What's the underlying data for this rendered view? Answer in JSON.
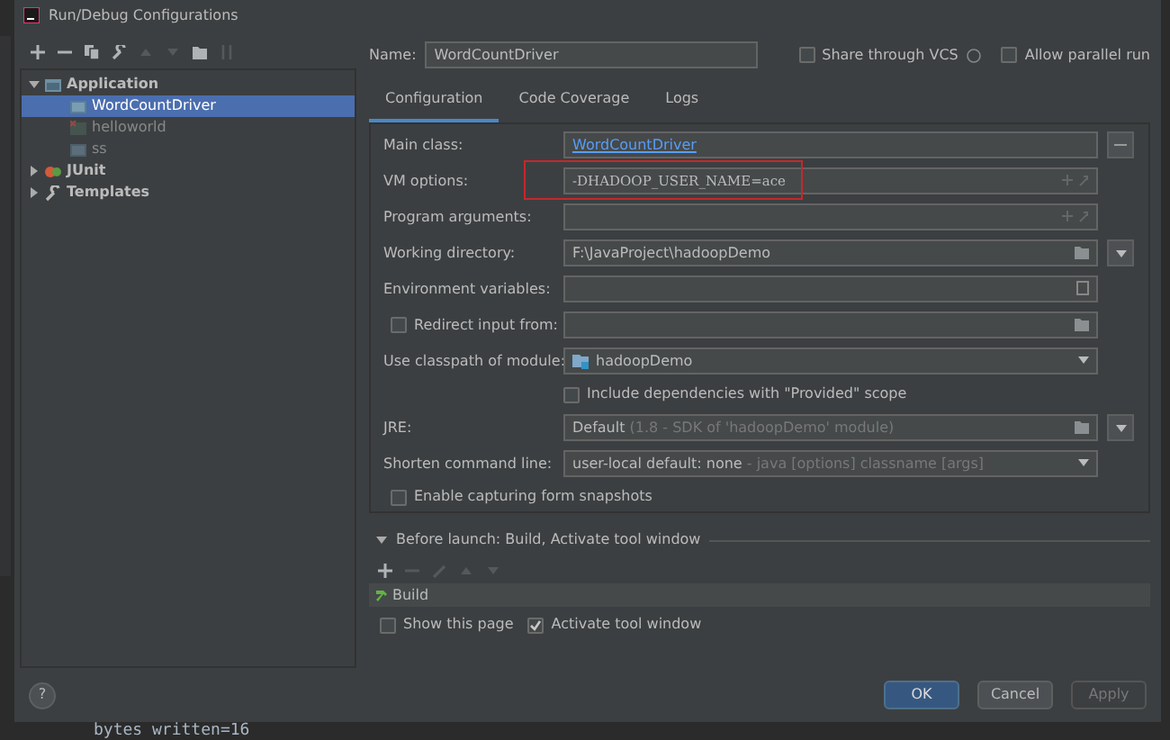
{
  "window": {
    "title": "Run/Debug Configurations"
  },
  "toolbar": [
    {
      "kind": "add",
      "disabled": false
    },
    {
      "kind": "remove",
      "disabled": false
    },
    {
      "kind": "copy",
      "disabled": false
    },
    {
      "kind": "wrench",
      "disabled": false
    },
    {
      "kind": "up",
      "disabled": true
    },
    {
      "kind": "down",
      "disabled": true
    },
    {
      "kind": "folder",
      "disabled": false
    },
    {
      "kind": "sort",
      "disabled": true
    }
  ],
  "tree": [
    {
      "label": "Application",
      "kind": "application",
      "expanded": true,
      "selected": false,
      "children": [
        {
          "label": "WordCountDriver",
          "kind": "class",
          "selected": true,
          "temporary": false
        },
        {
          "label": "helloworld",
          "kind": "class-error",
          "selected": false,
          "temporary": true
        },
        {
          "label": "ss",
          "kind": "class",
          "selected": false,
          "temporary": true
        }
      ]
    },
    {
      "label": "JUnit",
      "kind": "junit",
      "expanded": false,
      "selected": false
    },
    {
      "label": "Templates",
      "kind": "templates",
      "expanded": false,
      "selected": false
    }
  ],
  "name": {
    "label": "Name:",
    "value": "WordCountDriver"
  },
  "share_vcs": {
    "label": "Share through VCS",
    "checked": false
  },
  "allow_parallel": {
    "label": "Allow parallel run",
    "checked": false
  },
  "tabs": [
    {
      "label": "Configuration",
      "selected": true
    },
    {
      "label": "Code Coverage",
      "selected": false
    },
    {
      "label": "Logs",
      "selected": false
    }
  ],
  "form": [
    {
      "kind": "link-field",
      "label": "Main class:",
      "value": "WordCountDriver"
    },
    {
      "kind": "expand-field",
      "label": "VM options:",
      "value": "-DHADOOP_USER_NAME=ace",
      "highlighted": true
    },
    {
      "kind": "expand-field",
      "label": "Program arguments:",
      "highlighted": false
    },
    {
      "kind": "folder-dropdown",
      "label": "Working directory:",
      "value": "F:\\JavaProject\\hadoopDemo"
    },
    {
      "kind": "env-field",
      "label": "Environment variables:"
    },
    {
      "kind": "checkbox-field",
      "label": "Redirect input from:",
      "checked": false
    },
    {
      "kind": "module-select",
      "label": "Use classpath of module:",
      "value": "hadoopDemo"
    },
    {
      "kind": "sub-checkbox",
      "label": "Include dependencies with \"Provided\" scope",
      "checked": false
    },
    {
      "kind": "jre",
      "label": "JRE:",
      "value": "Default",
      "hint": "(1.8 - SDK of 'hadoopDemo' module)"
    },
    {
      "kind": "select",
      "label": "Shorten command line:",
      "value": "user-local default: none",
      "hint": "- java [options] classname [args]"
    },
    {
      "kind": "checkbox",
      "label": "Enable capturing form snapshots",
      "checked": false
    }
  ],
  "before_launch": {
    "title": "Before launch: Build, Activate tool window",
    "expanded": true,
    "toolbar": [
      {
        "kind": "add",
        "disabled": false
      },
      {
        "kind": "remove",
        "disabled": true
      },
      {
        "kind": "edit",
        "disabled": true
      },
      {
        "kind": "up",
        "disabled": true
      },
      {
        "kind": "down",
        "disabled": true
      }
    ],
    "tasks": [
      {
        "label": "Build"
      }
    ],
    "show_page": {
      "label": "Show this page",
      "checked": false
    },
    "activate": {
      "label": "Activate tool window",
      "checked": true
    }
  },
  "help": "?",
  "buttons": [
    {
      "label": "OK",
      "kind": "primary",
      "disabled": false
    },
    {
      "label": "Cancel",
      "kind": "default",
      "disabled": false
    },
    {
      "label": "Apply",
      "kind": "default",
      "disabled": true
    }
  ],
  "background_console": {
    "text": "bytes written=16"
  }
}
